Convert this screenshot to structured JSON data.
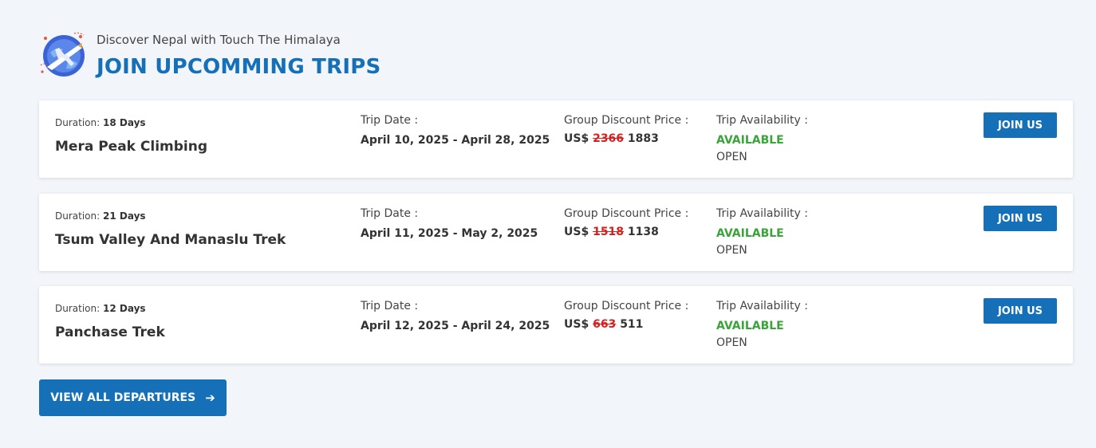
{
  "header": {
    "subtitle": "Discover Nepal with Touch The Himalaya",
    "title": "JOIN UPCOMMING TRIPS",
    "icon": "airplane-globe-icon"
  },
  "labels": {
    "duration": "Duration:",
    "trip_date": "Trip Date :",
    "group_price": "Group Discount Price :",
    "availability": "Trip Availability :",
    "currency": "US$",
    "join": "JOIN US"
  },
  "trips": [
    {
      "duration": "18 Days",
      "name": "Mera Peak Climbing",
      "date": "April 10, 2025 - April 28, 2025",
      "old_price": "2366",
      "price": "1883",
      "status": "AVAILABLE",
      "state": "OPEN"
    },
    {
      "duration": "21 Days",
      "name": "Tsum Valley And Manaslu Trek",
      "date": "April 11, 2025 - May 2, 2025",
      "old_price": "1518",
      "price": "1138",
      "status": "AVAILABLE",
      "state": "OPEN"
    },
    {
      "duration": "12 Days",
      "name": "Panchase Trek",
      "date": "April 12, 2025 - April 24, 2025",
      "old_price": "663",
      "price": "511",
      "status": "AVAILABLE",
      "state": "OPEN"
    }
  ],
  "view_all": {
    "label": "VIEW ALL DEPARTURES",
    "icon": "arrow-right-icon"
  },
  "colors": {
    "accent": "#1570b8",
    "available": "#3aa33a",
    "old_price": "#d81f1f",
    "background": "#f2f6fa"
  }
}
